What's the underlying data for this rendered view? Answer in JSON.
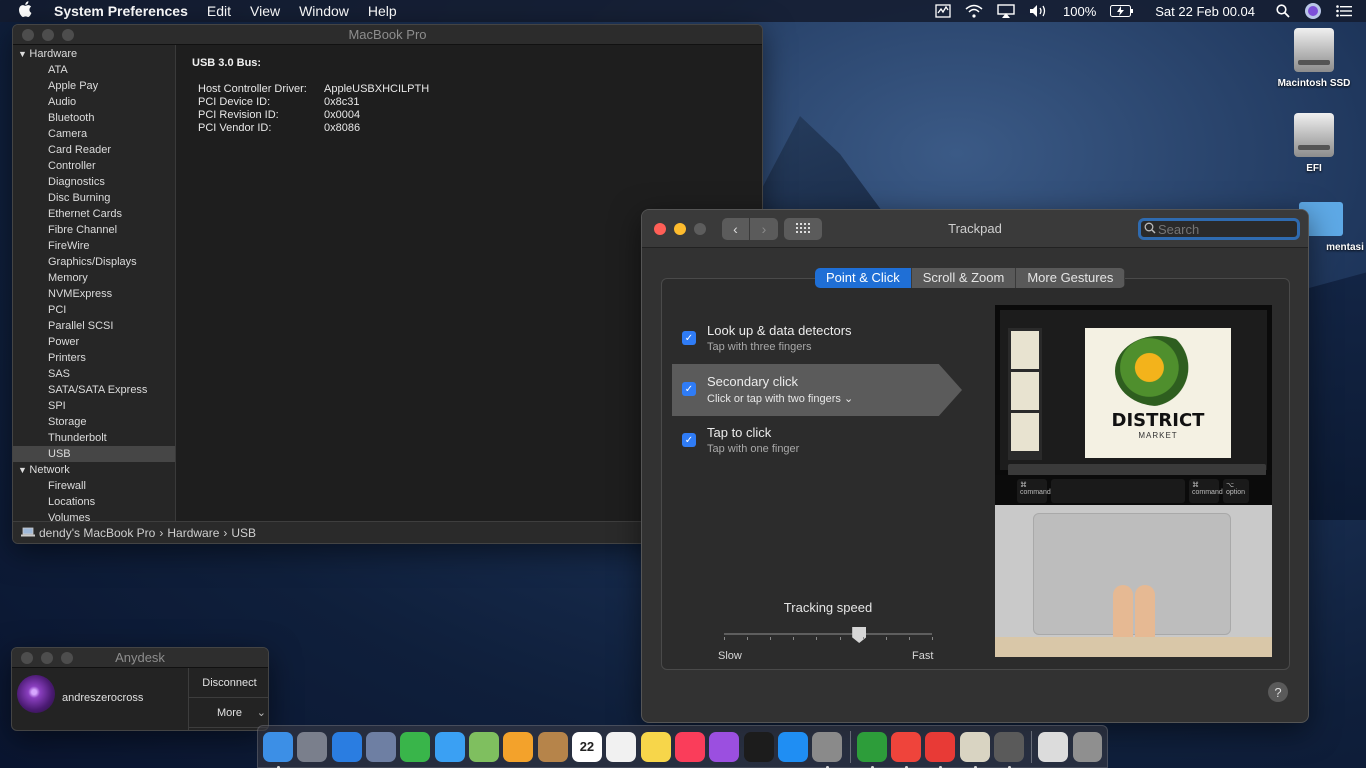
{
  "menubar": {
    "app_name": "System Preferences",
    "menus": [
      "Edit",
      "View",
      "Window",
      "Help"
    ],
    "battery": "100%",
    "datetime": "Sat 22 Feb  00.04"
  },
  "sysinfo": {
    "title": "MacBook Pro",
    "groups": [
      {
        "label": "Hardware",
        "items": [
          "ATA",
          "Apple Pay",
          "Audio",
          "Bluetooth",
          "Camera",
          "Card Reader",
          "Controller",
          "Diagnostics",
          "Disc Burning",
          "Ethernet Cards",
          "Fibre Channel",
          "FireWire",
          "Graphics/Displays",
          "Memory",
          "NVMExpress",
          "PCI",
          "Parallel SCSI",
          "Power",
          "Printers",
          "SAS",
          "SATA/SATA Express",
          "SPI",
          "Storage",
          "Thunderbolt",
          "USB"
        ]
      },
      {
        "label": "Network",
        "items": [
          "Firewall",
          "Locations",
          "Volumes"
        ]
      }
    ],
    "selected": "USB",
    "detail_title": "USB 3.0 Bus:",
    "details": [
      {
        "k": "Host Controller Driver:",
        "v": "AppleUSBXHCILPTH"
      },
      {
        "k": "PCI Device ID:",
        "v": "0x8c31"
      },
      {
        "k": "PCI Revision ID:",
        "v": "0x0004"
      },
      {
        "k": "PCI Vendor ID:",
        "v": "0x8086"
      }
    ],
    "path": [
      "dendy's MacBook Pro",
      "Hardware",
      "USB"
    ]
  },
  "trackpad": {
    "title": "Trackpad",
    "search_placeholder": "Search",
    "tabs": [
      "Point & Click",
      "Scroll & Zoom",
      "More Gestures"
    ],
    "active_tab": "Point & Click",
    "options": [
      {
        "title": "Look up & data detectors",
        "sub": "Tap with three fingers",
        "checked": true
      },
      {
        "title": "Secondary click",
        "sub": "Click or tap with two fingers",
        "checked": true
      },
      {
        "title": "Tap to click",
        "sub": "Tap with one finger",
        "checked": true
      }
    ],
    "preview": {
      "doc_title": "DISTRICT",
      "doc_sub": "MARKET",
      "key_left": "command",
      "key_right": "command",
      "key_option": "option"
    },
    "tracking_label": "Tracking speed",
    "tracking_level": 0.65,
    "slow": "Slow",
    "fast": "Fast",
    "help": "?"
  },
  "anydesk": {
    "title": "Anydesk",
    "user": "andreszerocross",
    "disconnect": "Disconnect",
    "more": "More"
  },
  "desktop": {
    "icons": [
      "Macintosh SSD",
      "EFI",
      "mentasi"
    ]
  },
  "dock": {
    "apps": [
      {
        "name": "finder",
        "color": "#3c8fe6",
        "run": true
      },
      {
        "name": "launchpad",
        "color": "#7a7f8c",
        "run": false
      },
      {
        "name": "safari",
        "color": "#2a7de1",
        "run": false
      },
      {
        "name": "preview-app",
        "color": "#6e7fa3",
        "run": false
      },
      {
        "name": "facetime",
        "color": "#39b54a",
        "run": false
      },
      {
        "name": "messages",
        "color": "#3aa0f3",
        "run": false
      },
      {
        "name": "maps",
        "color": "#7fbf5f",
        "run": false
      },
      {
        "name": "photos",
        "color": "#f3a22b",
        "run": false
      },
      {
        "name": "notebook",
        "color": "#b6844a",
        "run": false
      },
      {
        "name": "calendar",
        "color": "#ffffff",
        "run": false
      },
      {
        "name": "reminders",
        "color": "#f1f1f1",
        "run": false
      },
      {
        "name": "notes",
        "color": "#f7d64a",
        "run": false
      },
      {
        "name": "music",
        "color": "#fa3d5a",
        "run": false
      },
      {
        "name": "podcasts",
        "color": "#9b4fe0",
        "run": false
      },
      {
        "name": "apple-tv",
        "color": "#1c1c1c",
        "run": false
      },
      {
        "name": "app-store",
        "color": "#1f8ef3",
        "run": false
      },
      {
        "name": "system-preferences",
        "color": "#8a8a8a",
        "run": true
      }
    ],
    "apps2": [
      {
        "name": "green-app",
        "color": "#2d9d3a",
        "run": true
      },
      {
        "name": "anydesk-app",
        "color": "#ef443b",
        "run": true
      },
      {
        "name": "anydesk-app-2",
        "color": "#e83a36",
        "run": true
      },
      {
        "name": "file-app",
        "color": "#d9d4c2",
        "run": true
      },
      {
        "name": "utility-app",
        "color": "#5a5a5a",
        "run": true
      }
    ],
    "apps3": [
      {
        "name": "documents",
        "color": "#dcdcdc",
        "run": false
      },
      {
        "name": "trash",
        "color": "#8f8f8f",
        "run": false
      }
    ],
    "calendar_day": "22"
  }
}
